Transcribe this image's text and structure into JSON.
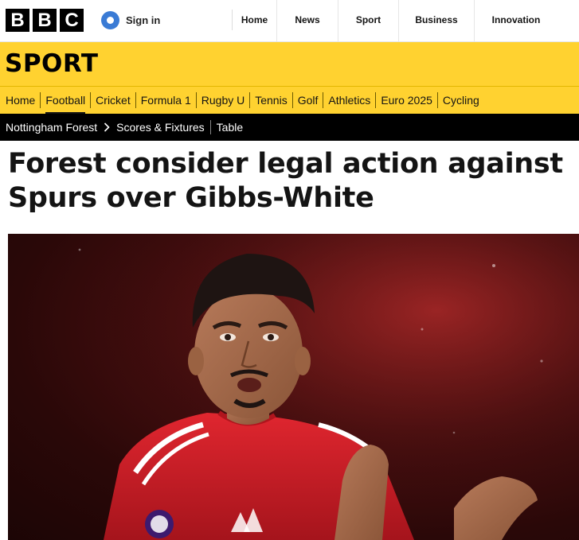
{
  "brand": {
    "letters": [
      "B",
      "B",
      "C"
    ]
  },
  "account": {
    "sign_in_label": "Sign in"
  },
  "top_nav": {
    "items": [
      {
        "label": "Home"
      },
      {
        "label": "News"
      },
      {
        "label": "Sport"
      },
      {
        "label": "Business"
      },
      {
        "label": "Innovation"
      }
    ]
  },
  "section": {
    "title": "SPORT"
  },
  "sport_nav": {
    "items": [
      {
        "label": "Home"
      },
      {
        "label": "Football",
        "active": true
      },
      {
        "label": "Cricket"
      },
      {
        "label": "Formula 1"
      },
      {
        "label": "Rugby U"
      },
      {
        "label": "Tennis"
      },
      {
        "label": "Golf"
      },
      {
        "label": "Athletics"
      },
      {
        "label": "Euro 2025"
      },
      {
        "label": "Cycling"
      }
    ]
  },
  "sub_nav": {
    "team": "Nottingham Forest",
    "scores": "Scores & Fixtures",
    "table": "Table"
  },
  "article": {
    "headline": "Forest consider legal action against Spurs over Gibbs-White"
  },
  "colors": {
    "sport_yellow": "#ffd230",
    "signin_blue": "#3a7bd5",
    "kit_red": "#d0202a"
  },
  "icons": {
    "account": "user-icon",
    "breadcrumb": "chevron-right-icon"
  }
}
